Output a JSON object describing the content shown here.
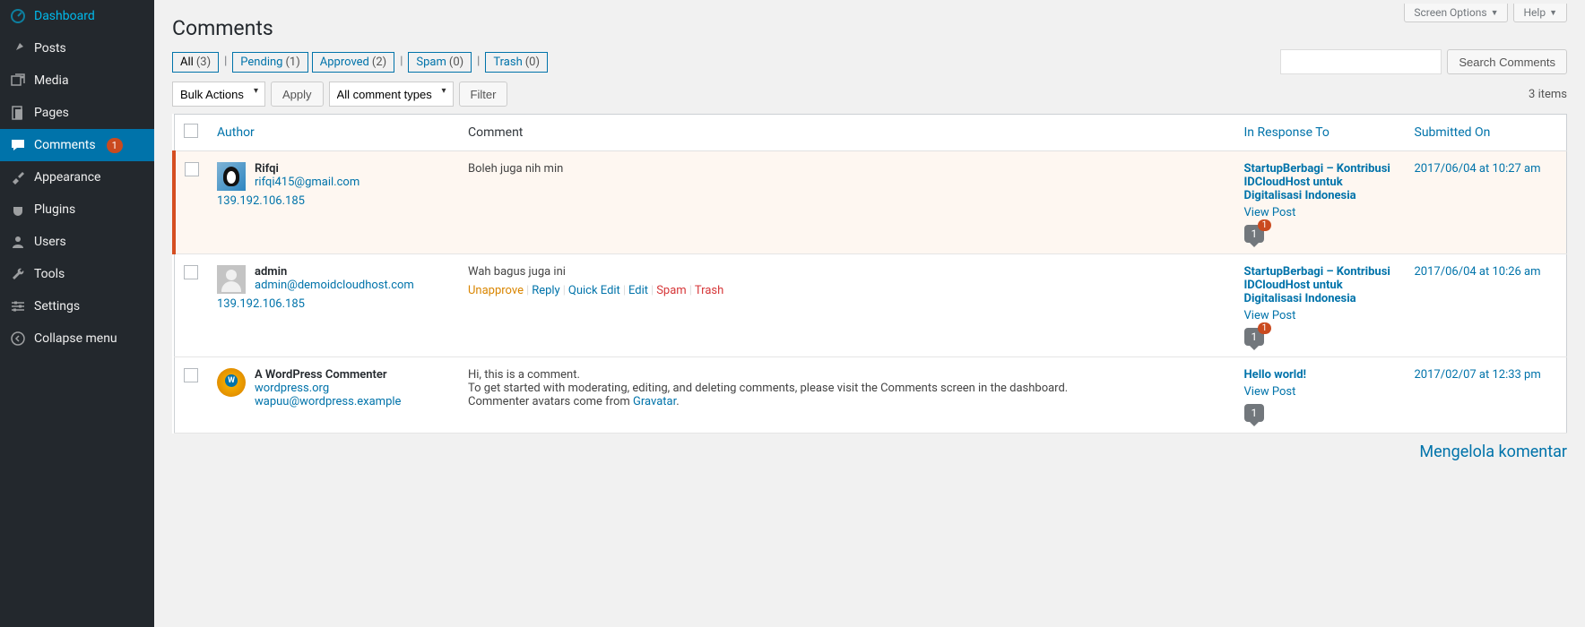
{
  "top_tabs": {
    "screen_options": "Screen Options",
    "help": "Help"
  },
  "page_title": "Comments",
  "sidebar": {
    "items": [
      {
        "label": "Dashboard"
      },
      {
        "label": "Posts"
      },
      {
        "label": "Media"
      },
      {
        "label": "Pages"
      },
      {
        "label": "Comments",
        "badge": "1"
      },
      {
        "label": "Appearance"
      },
      {
        "label": "Plugins"
      },
      {
        "label": "Users"
      },
      {
        "label": "Tools"
      },
      {
        "label": "Settings"
      },
      {
        "label": "Collapse menu"
      }
    ]
  },
  "filters": {
    "all_label": "All",
    "all_count": "(3)",
    "pending_label": "Pending",
    "pending_count": "(1)",
    "approved_label": "Approved",
    "approved_count": "(2)",
    "spam_label": "Spam",
    "spam_count": "(0)",
    "trash_label": "Trash",
    "trash_count": "(0)"
  },
  "search": {
    "button": "Search Comments",
    "placeholder": ""
  },
  "bulk": {
    "label": "Bulk Actions",
    "apply": "Apply",
    "type": "All comment types",
    "filter": "Filter",
    "count": "3 items"
  },
  "columns": {
    "author": "Author",
    "comment": "Comment",
    "response": "In Response To",
    "submitted": "Submitted On"
  },
  "row_actions": {
    "unapprove": "Unapprove",
    "reply": "Reply",
    "quick_edit": "Quick Edit",
    "edit": "Edit",
    "spam": "Spam",
    "trash": "Trash"
  },
  "view_post": "View Post",
  "comments": [
    {
      "author_name": "Rifqi",
      "author_email": "rifqi415@gmail.com",
      "author_url": "",
      "author_ip": "139.192.106.185",
      "content": "Boleh juga nih min",
      "post_title": "StartupBerbagi – Kontribusi IDCloudHost untuk Digitalisasi Indonesia",
      "submitted": "2017/06/04 at 10:27 am",
      "bubble": "1",
      "bubble_pending": "1",
      "unapproved": true,
      "show_actions": false,
      "avatar": "penguin"
    },
    {
      "author_name": "admin",
      "author_email": "admin@demoidcloudhost.com",
      "author_url": "",
      "author_ip": "139.192.106.185",
      "content": "Wah bagus juga ini",
      "post_title": "StartupBerbagi – Kontribusi IDCloudHost untuk Digitalisasi Indonesia",
      "submitted": "2017/06/04 at 10:26 am",
      "bubble": "1",
      "bubble_pending": "1",
      "unapproved": false,
      "show_actions": true,
      "avatar": "default"
    },
    {
      "author_name": "A WordPress Commenter",
      "author_email": "wapuu@wordpress.example",
      "author_url": "wordpress.org",
      "author_ip": "",
      "content_pre": "Hi, this is a comment.\nTo get started with moderating, editing, and deleting comments, please visit the Comments screen in the dashboard.\nCommenter avatars come from ",
      "content_link": "Gravatar",
      "content_post": ".",
      "post_title": "Hello world!",
      "submitted": "2017/02/07 at 12:33 pm",
      "bubble": "1",
      "unapproved": false,
      "show_actions": false,
      "avatar": "wapuu"
    }
  ],
  "bottom_link": "Mengelola komentar"
}
